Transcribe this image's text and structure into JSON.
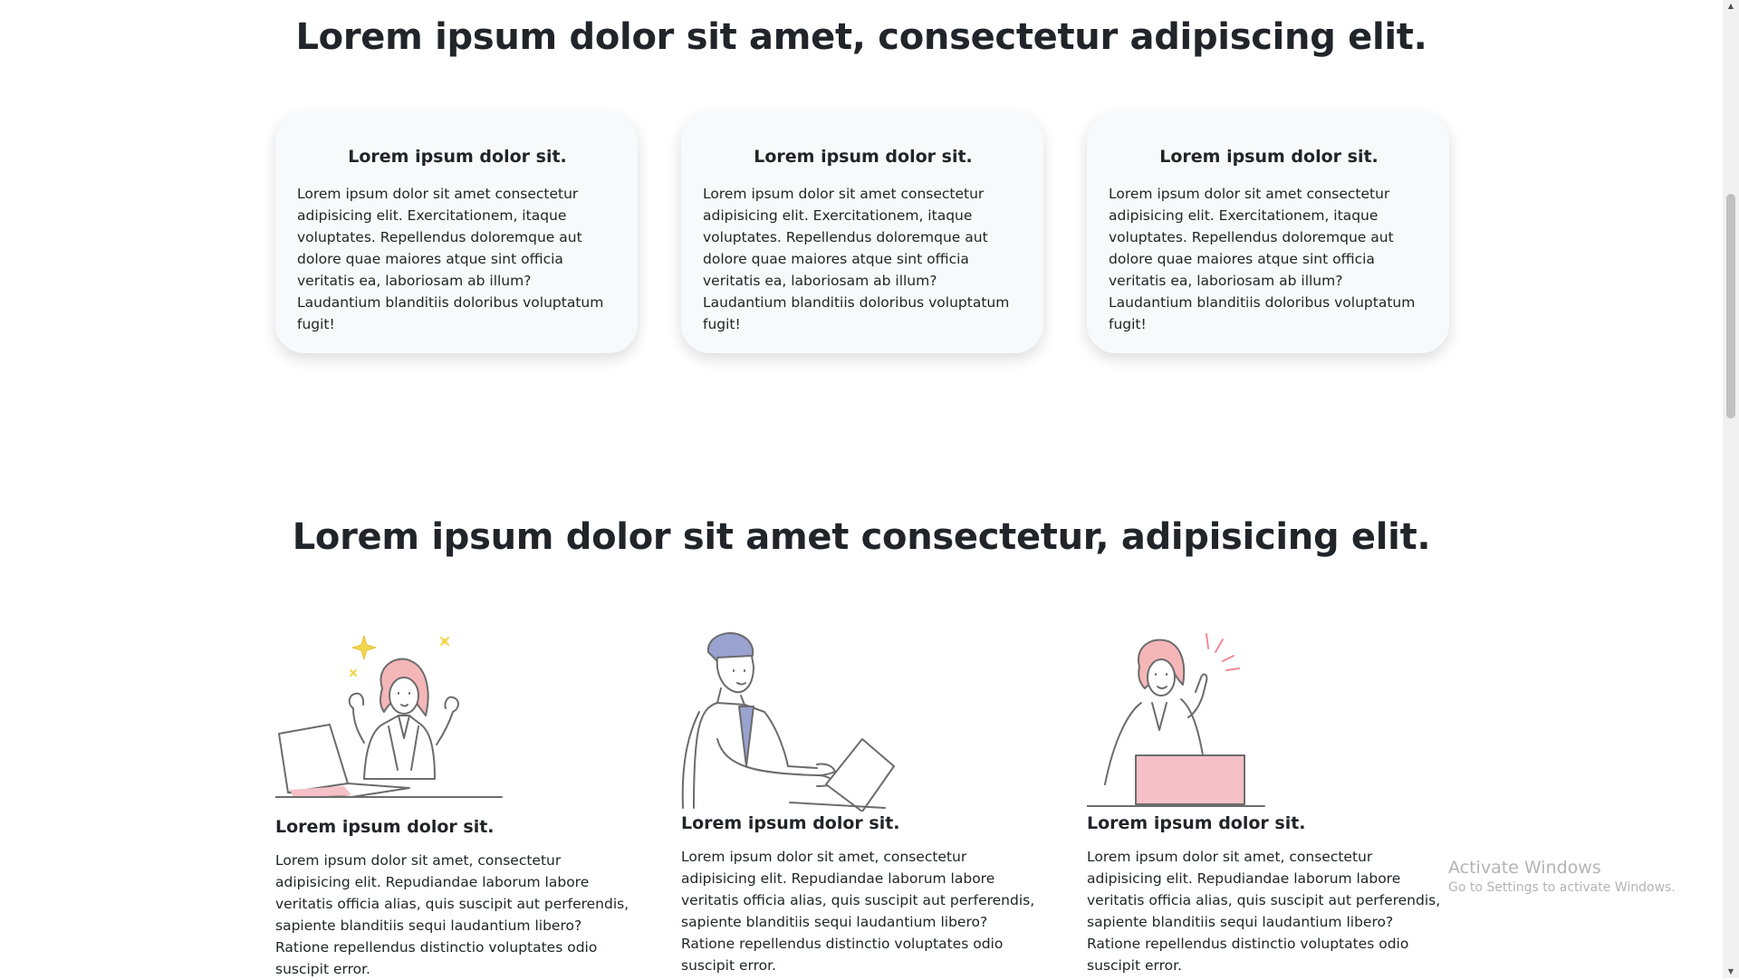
{
  "section1": {
    "heading": "Lorem ipsum dolor sit amet, consectetur adipiscing elit.",
    "cards": [
      {
        "title": "Lorem ipsum dolor sit.",
        "text": "Lorem ipsum dolor sit amet consectetur adipisicing elit. Exercitationem, itaque voluptates. Repellendus doloremque aut dolore quae maiores atque sint officia veritatis ea, laboriosam ab illum? Laudantium blanditiis doloribus voluptatum fugit!"
      },
      {
        "title": "Lorem ipsum dolor sit.",
        "text": "Lorem ipsum dolor sit amet consectetur adipisicing elit. Exercitationem, itaque voluptates. Repellendus doloremque aut dolore quae maiores atque sint officia veritatis ea, laboriosam ab illum? Laudantium blanditiis doloribus voluptatum fugit!"
      },
      {
        "title": "Lorem ipsum dolor sit.",
        "text": "Lorem ipsum dolor sit amet consectetur adipisicing elit. Exercitationem, itaque voluptates. Repellendus doloremque aut dolore quae maiores atque sint officia veritatis ea, laboriosam ab illum? Laudantium blanditiis doloribus voluptatum fugit!"
      }
    ]
  },
  "section2": {
    "heading": "Lorem ipsum dolor sit amet consectetur, adipisicing elit.",
    "features": [
      {
        "illustration": "woman-celebrating-laptop-illustration",
        "title": "Lorem ipsum dolor sit.",
        "text": "Lorem ipsum dolor sit amet, consectetur adipisicing elit. Repudiandae laborum labore veritatis officia alias, quis suscipit aut perferendis, sapiente blanditiis sequi laudantium libero? Ratione repellendus distinctio voluptates odio suscipit error."
      },
      {
        "illustration": "man-typing-laptop-illustration",
        "title": "Lorem ipsum dolor sit.",
        "text": "Lorem ipsum dolor sit amet, consectetur adipisicing elit. Repudiandae laborum labore veritatis officia alias, quis suscipit aut perferendis, sapiente blanditiis sequi laudantium libero? Ratione repellendus distinctio voluptates odio suscipit error."
      },
      {
        "illustration": "woman-idea-laptop-illustration",
        "title": "Lorem ipsum dolor sit.",
        "text": "Lorem ipsum dolor sit amet, consectetur adipisicing elit. Repudiandae laborum labore veritatis officia alias, quis suscipit aut perferendis, sapiente blanditiis sequi laudantium libero? Ratione repellendus distinctio voluptates odio suscipit error."
      }
    ]
  },
  "watermark": {
    "title": "Activate Windows",
    "subtitle": "Go to Settings to activate Windows."
  },
  "colors": {
    "accent_pink": "#f5c0c6",
    "accent_blue": "#9aa2d0",
    "sparkle_yellow": "#f3d54e",
    "line_gray": "#6c6c6c",
    "card_bg": "#f8f9fa"
  }
}
